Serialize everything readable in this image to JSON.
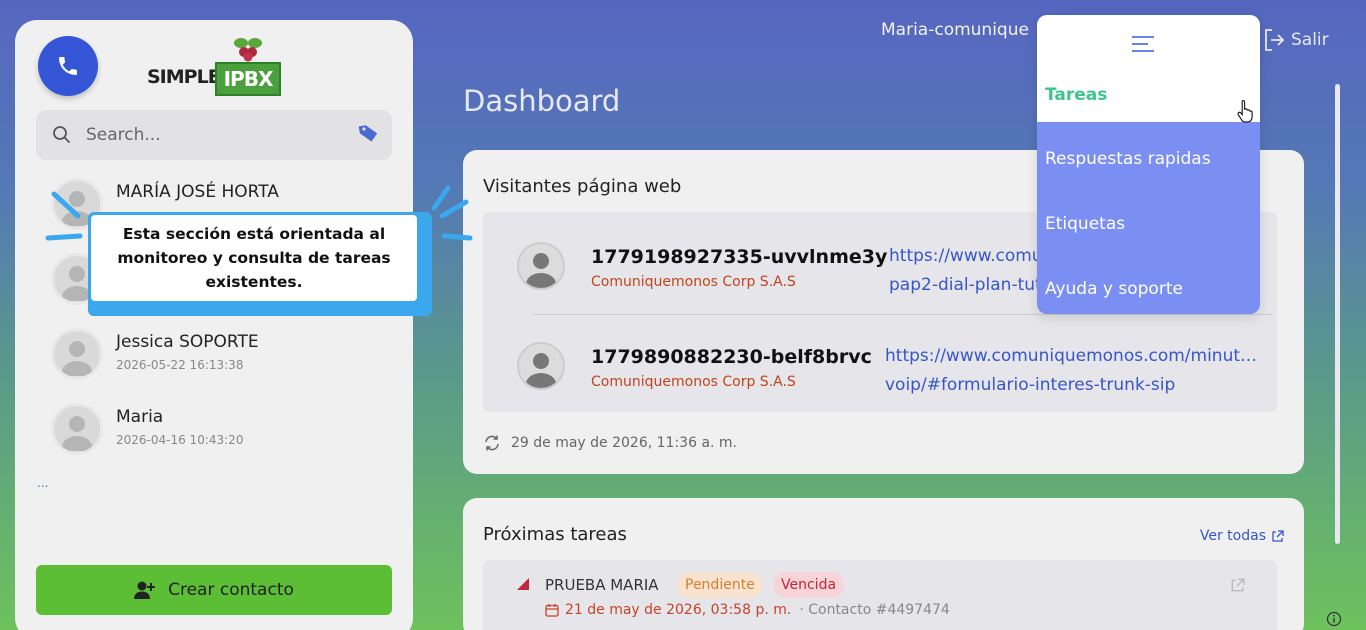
{
  "sidebar": {
    "search_placeholder": "Search...",
    "logo_text": "SIMPLE",
    "logo_box": "IPBX",
    "contacts": [
      {
        "name": "MARÍA JOSÉ HORTA",
        "date": ""
      },
      {
        "name": "",
        "date": ""
      },
      {
        "name": "Jessica SOPORTE",
        "date": "2026-05-22 16:13:38"
      },
      {
        "name": "Maria",
        "date": "2026-04-16 10:43:20"
      }
    ],
    "more": "...",
    "create_contact": "Crear contacto"
  },
  "tooltip": {
    "text": "Esta sección está orientada al monitoreo y consulta de tareas existentes."
  },
  "header": {
    "user": "Maria-comunique",
    "logout": "Salir",
    "title": "Dashboard"
  },
  "visitors": {
    "title": "Visitantes página web",
    "items": [
      {
        "id": "1779198927335-uvvlnme3y",
        "company": "Comuniquemonos Corp S.A.S",
        "url_line1": "https://www.comun",
        "url_line2": "pap2-dial-plan-tuto"
      },
      {
        "id": "1779890882230-belf8brvc",
        "company": "Comuniquemonos Corp S.A.S",
        "url_line1": "https://www.comuniquemonos.com/minut…",
        "url_line2": "voip/#formulario-interes-trunk-sip"
      }
    ],
    "updated": "29 de may de 2026, 11:36 a. m."
  },
  "tasks": {
    "title": "Próximas tareas",
    "view_all": "Ver todas",
    "items": [
      {
        "name": "PRUEBA MARIA",
        "status": "Pendiente",
        "overdue": "Vencida",
        "date": "21 de may de 2026, 03:58 p. m.",
        "contact": "· Contacto #4497474"
      }
    ]
  },
  "menu": {
    "items": [
      "Tareas",
      "Respuestas rapidas",
      "Etiquetas",
      "Ayuda y soporte"
    ],
    "active": "Tareas"
  },
  "colors": {
    "accent": "#3456d6",
    "menu_bg": "#7b8ff3",
    "active_menu": "#3cc68c",
    "create_button": "#5cbe34",
    "tooltip_border": "#3ba8ee"
  }
}
